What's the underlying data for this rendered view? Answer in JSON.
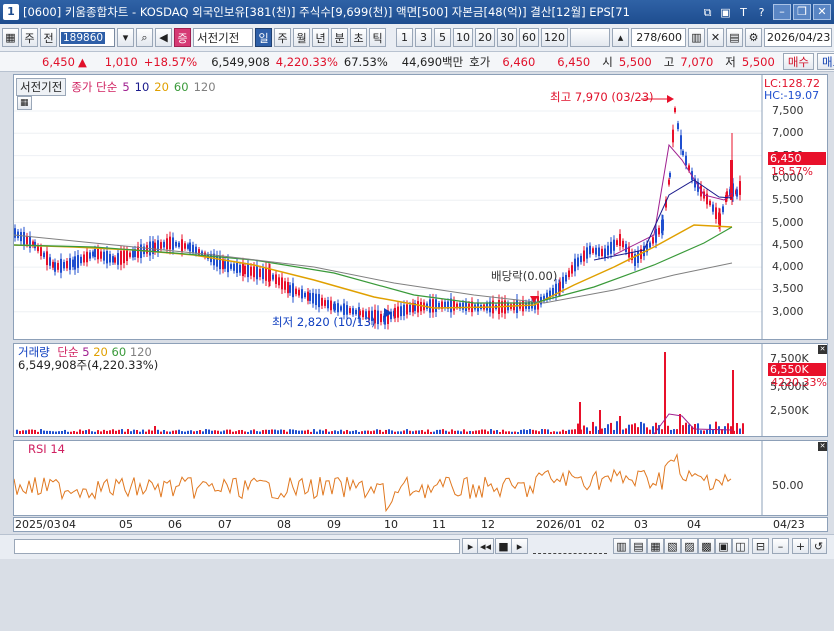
{
  "window": {
    "number": "1",
    "title": "[0600] 키움종합차트 - KOSDAQ 외국인보유[381(천)] 주식수[9,699(천)] 액면[500] 자본금[48(억)] 결산[12월] EPS[71",
    "icons": [
      "minimize-icon",
      "restore-icon",
      "close-icon"
    ]
  },
  "toolbar": {
    "period": "주",
    "prev": "전",
    "code": "189860",
    "stock_name": "서전기전",
    "buttons": [
      "일",
      "주",
      "월",
      "년",
      "분",
      "초",
      "틱"
    ],
    "intervals": [
      "1",
      "3",
      "5",
      "10",
      "20",
      "30",
      "60",
      "120"
    ],
    "counter": "278/600",
    "date": "2026/04/23"
  },
  "quote": {
    "price": "6,450",
    "arrow": "▲",
    "change": "1,010",
    "pct": "+18.57%",
    "volume": "6,549,908",
    "vol_ratio": "4,220.33%",
    "turnover": "67.53%",
    "amount": "44,690백만",
    "hoga_label": "호가",
    "ask": "6,460",
    "bid": "6,450",
    "open_label": "시",
    "open": "5,500",
    "high_label": "고",
    "high": "7,070",
    "low_label": "저",
    "low": "5,500",
    "buy": "매수",
    "sell": "매도"
  },
  "price_panel": {
    "legend_name": "서전기전",
    "ma_label": "종가 단순",
    "ma_periods": [
      "5",
      "10",
      "20",
      "60",
      "120"
    ],
    "lc": "LC:128.72",
    "hc": "HC:-19.07",
    "y_ticks": [
      "7,500",
      "7,000",
      "6,500",
      "6,000",
      "5,500",
      "5,000",
      "4,500",
      "4,000",
      "3,500",
      "3,000"
    ],
    "price_tag": "6,450",
    "pct_tag": "18.57%",
    "high_note": "최고 7,970 (03/23)",
    "low_note": "최저 2,820 (10/13)",
    "div_note": "배당락(0.00)"
  },
  "volume_panel": {
    "label": "거래량",
    "ma_label": "단순",
    "ma_periods": [
      "5",
      "20",
      "60",
      "120"
    ],
    "value_text": "6,549,908주(4,220.33%)",
    "y_ticks": [
      "7,500K",
      "5,000K",
      "2,500K"
    ],
    "vol_tag": "6,550K",
    "pct_tag": "4220.33%"
  },
  "rsi_panel": {
    "label": "RSI 14",
    "y_tick": "50.00"
  },
  "x_axis": {
    "labels": [
      "2025/03",
      "04",
      "05",
      "06",
      "07",
      "08",
      "09",
      "10",
      "11",
      "12",
      "2026/01",
      "02",
      "03",
      "04"
    ],
    "end_label": "04/23"
  },
  "colors": {
    "up": "#e8102a",
    "down": "#1f4fcf",
    "ma5": "#a02090",
    "ma10": "#1a1a8c",
    "ma20": "#e0a000",
    "ma60": "#3a9a3a",
    "ma120": "#808080",
    "rsi": "#e07820"
  }
}
